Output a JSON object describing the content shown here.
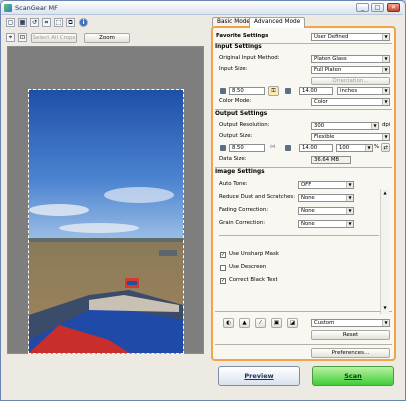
{
  "window": {
    "title": "ScanGear MF"
  },
  "toolbar": {
    "select_all_label": "Select All Crops",
    "zoom_label": "Zoom"
  },
  "tabs": [
    {
      "label": "Basic Mode"
    },
    {
      "label": "Advanced Mode"
    }
  ],
  "favorites": {
    "label": "Favorite Settings",
    "value": "User Defined"
  },
  "input_settings": {
    "title": "Input Settings",
    "original_input_method_label": "Original Input Method:",
    "original_input_method_value": "Platen Glass",
    "input_size_label": "Input Size:",
    "input_size_value": "Full Platen",
    "orientation_label": "Orientation...",
    "width_value": "8.50",
    "height_value": "14.00",
    "units_value": "inches",
    "color_mode_label": "Color Mode:",
    "color_mode_value": "Color"
  },
  "output_settings": {
    "title": "Output Settings",
    "resolution_label": "Output Resolution:",
    "resolution_value": "300",
    "resolution_unit": "dpi",
    "output_size_label": "Output Size:",
    "output_size_value": "Flexible",
    "width_value": "8.50",
    "height_value": "14.00",
    "scale_value": "100",
    "scale_unit": "%",
    "data_size_label": "Data Size:",
    "data_size_value": "36.64 MB"
  },
  "image_settings": {
    "title": "Image Settings",
    "auto_tone_label": "Auto Tone:",
    "auto_tone_value": "OFF",
    "dust_label": "Reduce Dust and Scratches:",
    "dust_value": "None",
    "fading_label": "Fading Correction:",
    "fading_value": "None",
    "grain_label": "Grain Correction:",
    "grain_value": "None",
    "unsharp_label": "Use Unsharp Mask",
    "unsharp_checked": true,
    "descreen_label": "Use Descreen",
    "descreen_checked": false,
    "black_text_label": "Correct Black Text",
    "black_text_checked": true
  },
  "adjust": {
    "preset_value": "Custom",
    "reset_label": "Reset"
  },
  "preferences_label": "Preferences...",
  "buttons": {
    "preview_label": "Preview",
    "scan_label": "Scan"
  }
}
